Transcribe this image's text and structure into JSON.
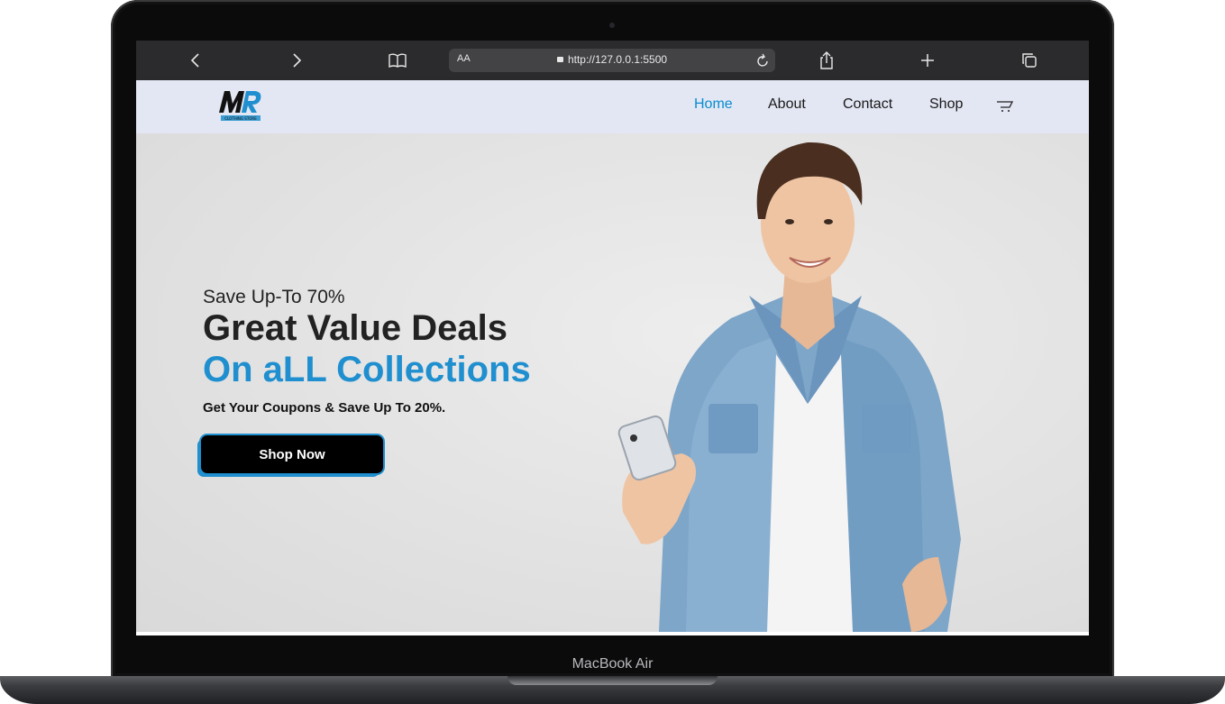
{
  "device": {
    "model_label": "MacBook Air"
  },
  "browser": {
    "url": "http://127.0.0.1:5500",
    "text_size_label": "AA",
    "icons": [
      "back-icon",
      "forward-icon",
      "reader-icon",
      "lock-icon",
      "reload-icon",
      "share-icon",
      "new-tab-icon",
      "tabs-icon"
    ]
  },
  "site": {
    "logo_text": "MR",
    "logo_subtext": "CLOTHING STORE",
    "nav": [
      {
        "label": "Home",
        "active": true
      },
      {
        "label": "About",
        "active": false
      },
      {
        "label": "Contact",
        "active": false
      },
      {
        "label": "Shop",
        "active": false
      }
    ],
    "cart_icon": "cart-icon",
    "accent_color": "#088dd0"
  },
  "hero": {
    "save_line": "Save Up-To 70%",
    "headline": "Great Value Deals",
    "headline_accent": "On aLL Collections",
    "coupon_line": "Get Your Coupons & Save Up To 20%.",
    "cta_label": "Shop Now",
    "image": "smiling man in denim shirt holding smartphone"
  }
}
